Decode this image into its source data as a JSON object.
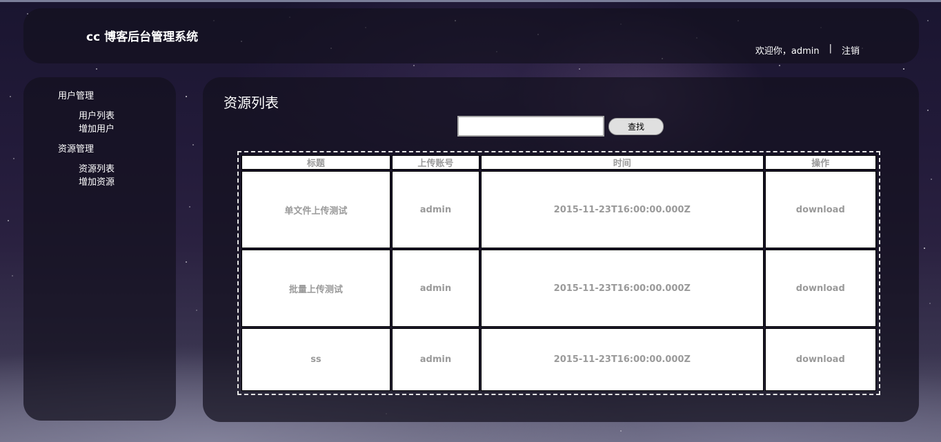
{
  "header": {
    "site_title": "cc 博客后台管理系统",
    "welcome_text": "欢迎你，admin",
    "separator": "|",
    "logout_label": "注销"
  },
  "sidebar": {
    "groups": [
      {
        "title": "用户管理",
        "items": [
          {
            "label": "用户列表"
          },
          {
            "label": "增加用户"
          }
        ]
      },
      {
        "title": "资源管理",
        "items": [
          {
            "label": "资源列表"
          },
          {
            "label": "增加资源"
          }
        ]
      }
    ]
  },
  "main": {
    "page_title": "资源列表",
    "search": {
      "value": "",
      "placeholder": "",
      "button_label": "查找"
    },
    "table": {
      "columns": [
        "标题",
        "上传账号",
        "时间",
        "操作"
      ],
      "rows": [
        {
          "title": "单文件上传测试",
          "account": "admin",
          "time": "2015-11-23T16:00:00.000Z",
          "action": "download"
        },
        {
          "title": "批量上传测试",
          "account": "admin",
          "time": "2015-11-23T16:00:00.000Z",
          "action": "download"
        },
        {
          "title": "ss",
          "account": "admin",
          "time": "2015-11-23T16:00:00.000Z",
          "action": "download"
        }
      ]
    }
  }
}
